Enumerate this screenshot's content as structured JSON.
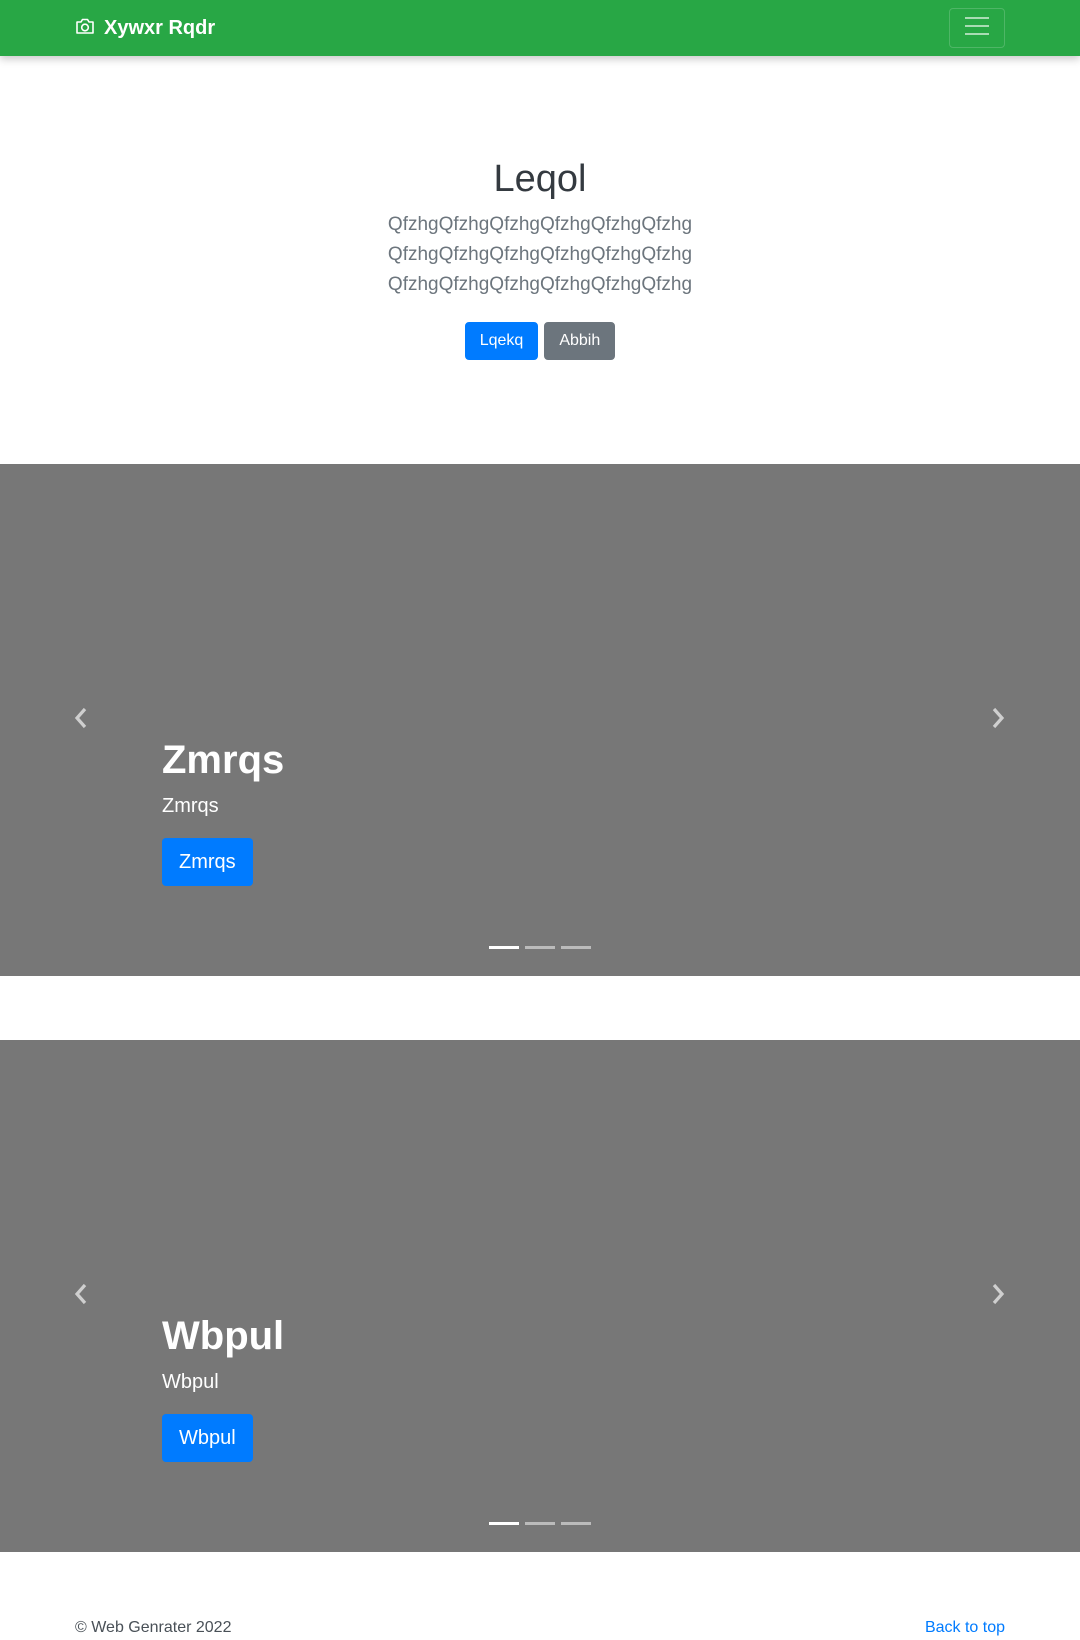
{
  "navbar": {
    "brand": "Xywxr Rqdr",
    "brand_icon": "camera-icon",
    "toggler_icon": "hamburger-menu-icon",
    "color": "#28a745"
  },
  "jumbotron": {
    "title": "Leqol",
    "lead_lines": [
      "QfzhgQfzhgQfzhgQfzhgQfzhgQfzhg",
      "QfzhgQfzhgQfzhgQfzhgQfzhgQfzhg",
      "QfzhgQfzhgQfzhgQfzhgQfzhgQfzhg"
    ],
    "primary_button": "Lqekq",
    "secondary_button": "Abbih"
  },
  "carousels": [
    {
      "title": "Zmrqs",
      "text": "Zmrqs",
      "button": "Zmrqs",
      "prev_icon": "chevron-left-icon",
      "next_icon": "chevron-right-icon",
      "indicators": 3,
      "active_indicator": 1
    },
    {
      "title": "Wbpul",
      "text": "Wbpul",
      "button": "Wbpul",
      "prev_icon": "chevron-left-icon",
      "next_icon": "chevron-right-icon",
      "indicators": 3,
      "active_indicator": 1
    }
  ],
  "footer": {
    "copyright": "© Web Genrater 2022",
    "back_to_top": "Back to top"
  },
  "colors": {
    "primary": "#007bff",
    "secondary": "#6c757d",
    "carousel_bg": "#777777"
  }
}
